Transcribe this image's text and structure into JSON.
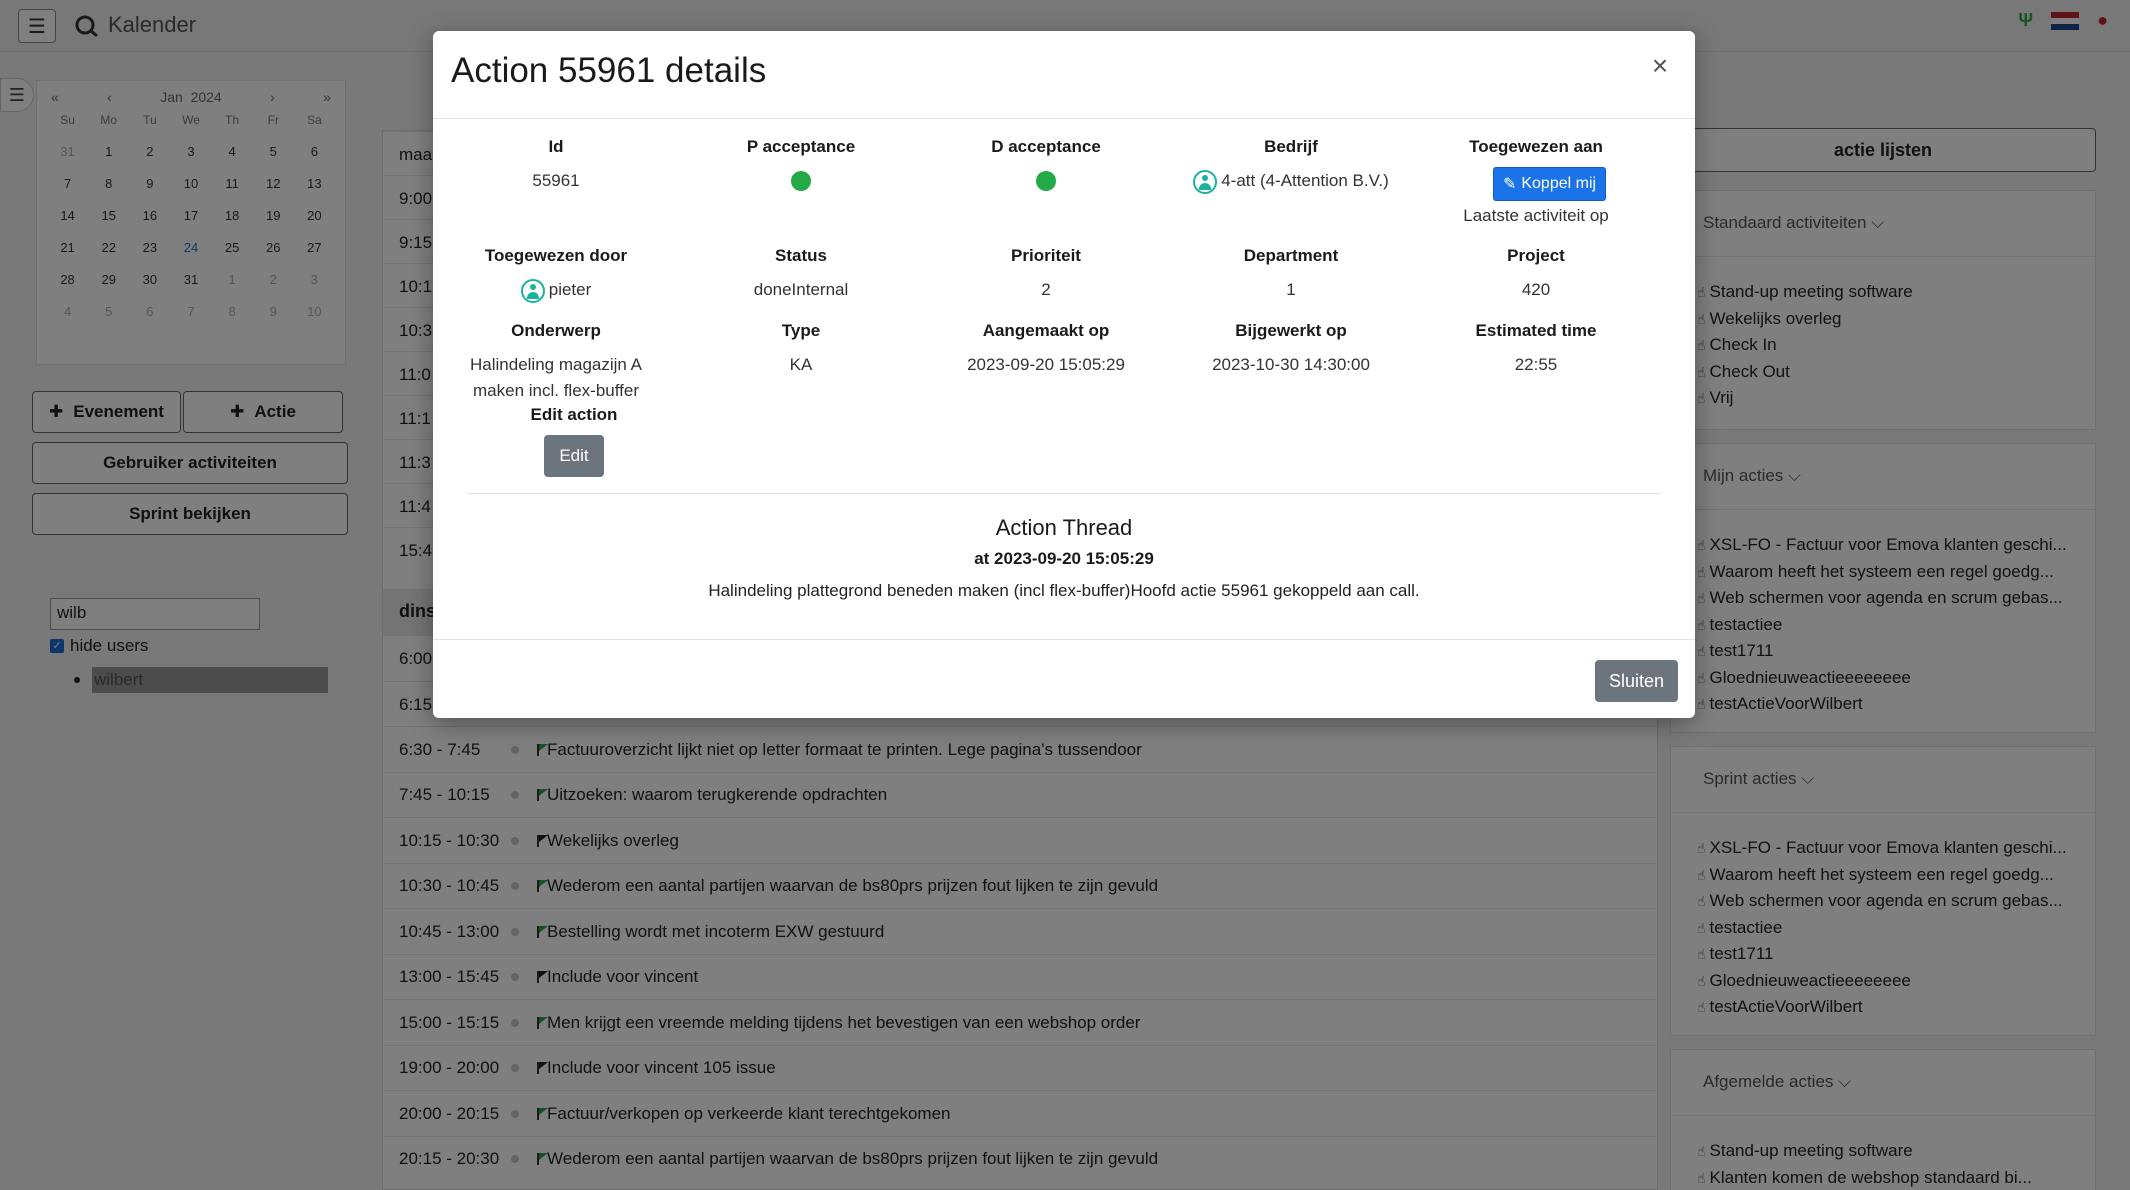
{
  "app": {
    "title": "Kalender"
  },
  "calendar": {
    "month": "Jan",
    "year": "2024",
    "nav": {
      "prev_year": "«",
      "prev": "‹",
      "next": "›",
      "next_year": "»"
    },
    "weekdays": [
      "Su",
      "Mo",
      "Tu",
      "We",
      "Th",
      "Fr",
      "Sa"
    ],
    "weeks": [
      [
        "31",
        "1",
        "2",
        "3",
        "4",
        "5",
        "6"
      ],
      [
        "7",
        "8",
        "9",
        "10",
        "11",
        "12",
        "13"
      ],
      [
        "14",
        "15",
        "16",
        "17",
        "18",
        "19",
        "20"
      ],
      [
        "21",
        "22",
        "23",
        "24",
        "25",
        "26",
        "27"
      ],
      [
        "28",
        "29",
        "30",
        "31",
        "1",
        "2",
        "3"
      ],
      [
        "4",
        "5",
        "6",
        "7",
        "8",
        "9",
        "10"
      ]
    ]
  },
  "sidebar": {
    "event_button": "Evenement",
    "action_button": "Actie",
    "user_activities_button": "Gebruiker activiteiten",
    "sprint_button": "Sprint bekijken",
    "user_search_value": "wilb",
    "hide_users_label": "hide users",
    "users": [
      "wilbert"
    ]
  },
  "agenda": {
    "partial_labels": [
      "maa",
      "9:00",
      "9:15",
      "10:1",
      "10:3",
      "11:0",
      "11:1",
      "11:3",
      "11:4",
      "15:4"
    ],
    "day_header": "dins",
    "partial_times": [
      "6:00",
      "6:15"
    ],
    "rows": [
      {
        "time": "6:30 - 7:45",
        "flag": "green",
        "text": "Factuuroverzicht lijkt niet op letter formaat te printen. Lege pagina's tussendoor"
      },
      {
        "time": "7:45 - 10:15",
        "flag": "green",
        "text": "Uitzoeken: waarom terugkerende opdrachten"
      },
      {
        "time": "10:15 - 10:30",
        "flag": "black",
        "text": "Wekelijks overleg"
      },
      {
        "time": "10:30 - 10:45",
        "flag": "green",
        "text": "Wederom een aantal partijen waarvan de bs80prs prijzen fout lijken te zijn gevuld"
      },
      {
        "time": "10:45 - 13:00",
        "flag": "green",
        "text": "Bestelling wordt met incoterm EXW gestuurd"
      },
      {
        "time": "13:00 - 15:45",
        "flag": "black",
        "text": "Include voor vincent"
      },
      {
        "time": "15:00 - 15:15",
        "flag": "green",
        "text": "Men krijgt een vreemde melding tijdens het bevestigen van een webshop order"
      },
      {
        "time": "19:00 - 20:00",
        "flag": "black",
        "text": "Include voor vincent 105 issue"
      },
      {
        "time": "20:00 - 20:15",
        "flag": "green",
        "text": "Factuur/verkopen op verkeerde klant terechtgekomen"
      },
      {
        "time": "20:15 - 20:30",
        "flag": "green",
        "text": "Wederom een aantal partijen waarvan de bs80prs prijzen fout lijken te zijn gevuld"
      }
    ]
  },
  "right_panel": {
    "title": "actie lijsten",
    "sections": [
      {
        "header": "Standaard activiteiten",
        "items": [
          "Stand-up meeting software",
          "Wekelijks overleg",
          "Check In",
          "Check Out",
          "Vrij"
        ]
      },
      {
        "header": "Mijn acties",
        "items": [
          "XSL-FO - Factuur voor Emova klanten geschi...",
          "Waarom heeft het systeem een regel goedg...",
          "Web schermen voor agenda en scrum gebas...",
          "testactiee",
          "test1711",
          "Gloednieuweactieeeeeeee",
          "testActieVoorWilbert"
        ]
      },
      {
        "header": "Sprint acties",
        "items": [
          "XSL-FO - Factuur voor Emova klanten geschi...",
          "Waarom heeft het systeem een regel goedg...",
          "Web schermen voor agenda en scrum gebas...",
          "testactiee",
          "test1711",
          "Gloednieuweactieeeeeeee",
          "testActieVoorWilbert"
        ]
      },
      {
        "header": "Afgemelde acties",
        "items": [
          "Stand-up meeting software",
          "Klanten komen de webshop standaard bi..."
        ]
      }
    ]
  },
  "modal": {
    "title": "Action 55961 details",
    "close": "×",
    "fields": {
      "id": {
        "label": "Id",
        "value": "55961"
      },
      "p_acceptance": {
        "label": "P acceptance",
        "status_color": "#23a948"
      },
      "d_acceptance": {
        "label": "D acceptance",
        "status_color": "#23a948"
      },
      "company": {
        "label": "Bedrijf",
        "value": "4-att (4-Attention B.V.)"
      },
      "assigned_to": {
        "label": "Toegewezen aan",
        "button": "Koppel mij",
        "note": "Laatste activiteit op"
      },
      "assigned_by": {
        "label": "Toegewezen door",
        "value": "pieter"
      },
      "status": {
        "label": "Status",
        "value": "doneInternal"
      },
      "priority": {
        "label": "Prioriteit",
        "value": "2"
      },
      "department": {
        "label": "Department",
        "value": "1"
      },
      "project": {
        "label": "Project",
        "value": "420"
      },
      "subject": {
        "label": "Onderwerp",
        "value": "Halindeling magazijn A maken incl. flex-buffer"
      },
      "type": {
        "label": "Type",
        "value": "KA"
      },
      "created": {
        "label": "Aangemaakt op",
        "value": "2023-09-20 15:05:29"
      },
      "updated": {
        "label": "Bijgewerkt op",
        "value": "2023-10-30 14:30:00"
      },
      "estimated": {
        "label": "Estimated time",
        "value": "22:55"
      },
      "edit_action": {
        "label": "Edit action",
        "button": "Edit"
      }
    },
    "thread": {
      "title": "Action Thread",
      "at": "at 2023-09-20 15:05:29",
      "text": "Halindeling plattegrond beneden maken (incl flex-buffer)Hoofd actie 55961 gekoppeld aan call."
    },
    "footer_button": "Sluiten"
  }
}
